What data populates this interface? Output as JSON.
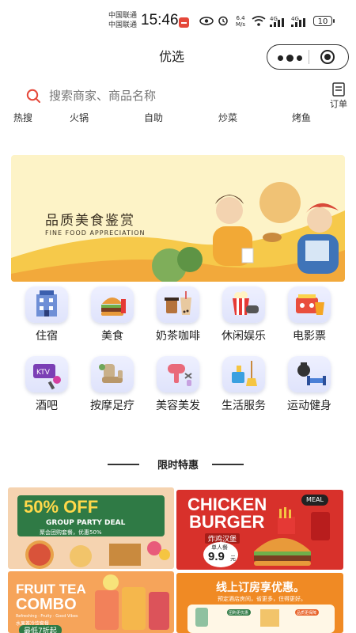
{
  "status_bar": {
    "carrier_1": "中国联通",
    "carrier_2": "中国联通",
    "time": "15:46",
    "net_speed_value": "6.4",
    "net_speed_unit": "M/s",
    "signal_1": "4G",
    "signal_2": "4G",
    "battery": "10"
  },
  "header": {
    "title": "优选"
  },
  "search": {
    "placeholder": "搜索商家、商品名称",
    "order_label": "订单"
  },
  "hot_tags": [
    "热搜",
    "火锅",
    "自助",
    "炒菜",
    "烤鱼"
  ],
  "banner": {
    "title": "品质美食鉴赏",
    "subtitle": "FINE FOOD APPRECIATION"
  },
  "categories": [
    {
      "label": "住宿",
      "icon": "hotel-icon"
    },
    {
      "label": "美食",
      "icon": "burger-icon"
    },
    {
      "label": "奶茶咖啡",
      "icon": "milk-tea-icon"
    },
    {
      "label": "休闲娱乐",
      "icon": "popcorn-gamepad-icon"
    },
    {
      "label": "电影票",
      "icon": "cinema-icon"
    },
    {
      "label": "酒吧",
      "icon": "ktv-icon"
    },
    {
      "label": "按摩足疗",
      "icon": "massage-chair-icon"
    },
    {
      "label": "美容美发",
      "icon": "hairdryer-icon"
    },
    {
      "label": "生活服务",
      "icon": "cleaning-icon"
    },
    {
      "label": "运动健身",
      "icon": "dumbbell-icon"
    }
  ],
  "section": {
    "title": "限时特惠"
  },
  "promos": {
    "a": {
      "headline": "50% OFF",
      "sub": "GROUP PARTY DEAL",
      "note": "聚会团购套餐，优惠50%"
    },
    "b": {
      "headline_1": "CHICKEN",
      "headline_2": "BURGER",
      "cn": "炸鸡汉堡",
      "price_label": "单人餐",
      "price": "9.9",
      "unit": "元",
      "badge": "MEAL"
    },
    "c": {
      "headline_1": "FRUIT TEA",
      "headline_2": "COMBO",
      "sub": "Refreshing · Fruity · Good Vibes",
      "cn": "水果茶冷饮套餐",
      "tag": "最低7折起"
    },
    "d": {
      "headline": "线上订房享优惠。",
      "sub": "预定酒店房间，省更多，住得更好。",
      "tag_1": "团购更优惠",
      "tag_2": "品质更保障"
    }
  },
  "colors": {
    "banner_bg": "#fdf3c7",
    "promo_red": "#d8312b",
    "promo_orange": "#f08a24",
    "search_icon": "#e5483a"
  }
}
